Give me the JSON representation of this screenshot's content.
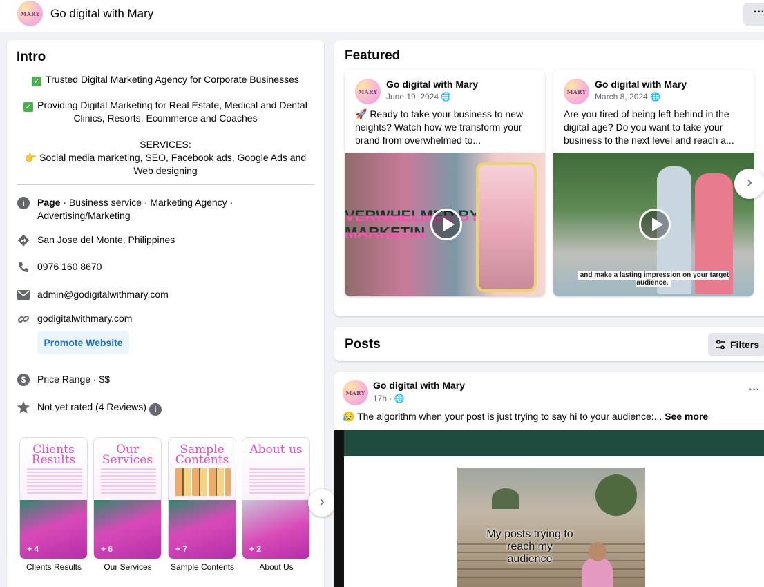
{
  "header": {
    "logo_text": "MARY",
    "page_name": "Go digital with Mary",
    "more_label": "···"
  },
  "intro": {
    "title": "Intro",
    "bio_1": "Trusted Digital Marketing Agency for Corporate Businesses",
    "bio_2": "Providing Digital Marketing for Real Estate, Medical and Dental Clinics, Resorts, Ecommerce and Coaches",
    "services_title": "SERVICES:",
    "services_text": "Social media marketing, SEO, Facebook ads, Google Ads and Web designing",
    "page_label": "Page",
    "page_category": " · Business service · Marketing Agency · Advertising/Marketing",
    "location": "San Jose del Monte, Philippines",
    "phone": "0976 160 8670",
    "email": "admin@godigitalwithmary.com",
    "website": "godigitalwithmary.com",
    "promote_label": "Promote Website",
    "price_range": "Price Range · $$",
    "rating": "Not yet rated (4 Reviews)",
    "highlights": [
      {
        "cover_title": "Clients Results",
        "count": "+ 4",
        "label": "Clients Results"
      },
      {
        "cover_title": "Our Services",
        "count": "+ 6",
        "label": "Our Services"
      },
      {
        "cover_title": "Sample Contents",
        "count": "+ 7",
        "label": "Sample Contents"
      },
      {
        "cover_title": "About us",
        "count": "+ 2",
        "label": "About Us"
      }
    ]
  },
  "featured": {
    "title": "Featured",
    "posts": [
      {
        "author": "Go digital with Mary",
        "date": "June 19, 2024",
        "text": "🚀 Ready to take your business to new heights? Watch how we transform your brand from overwhelmed to...",
        "overlay": "VERWHELMED BY MARKETIN"
      },
      {
        "author": "Go digital with Mary",
        "date": "March 8, 2024",
        "text": "Are you tired of being left behind in the digital age? Do you want to take your business to the next level and reach a...",
        "overlay": "and make a lasting impression on your target audience."
      }
    ]
  },
  "posts": {
    "title": "Posts",
    "filters_label": "Filters",
    "items": [
      {
        "author": "Go digital with Mary",
        "time": "17h · ",
        "text": "😥 The algorithm when your post is just trying to say hi to your audience:... ",
        "see_more": "See more",
        "meme_caption": "My posts trying to reach my audience"
      }
    ]
  },
  "colors": {
    "accent": "#1a6fd1",
    "check_green": "#4caf50",
    "brand_pink": "#e04ec2"
  }
}
